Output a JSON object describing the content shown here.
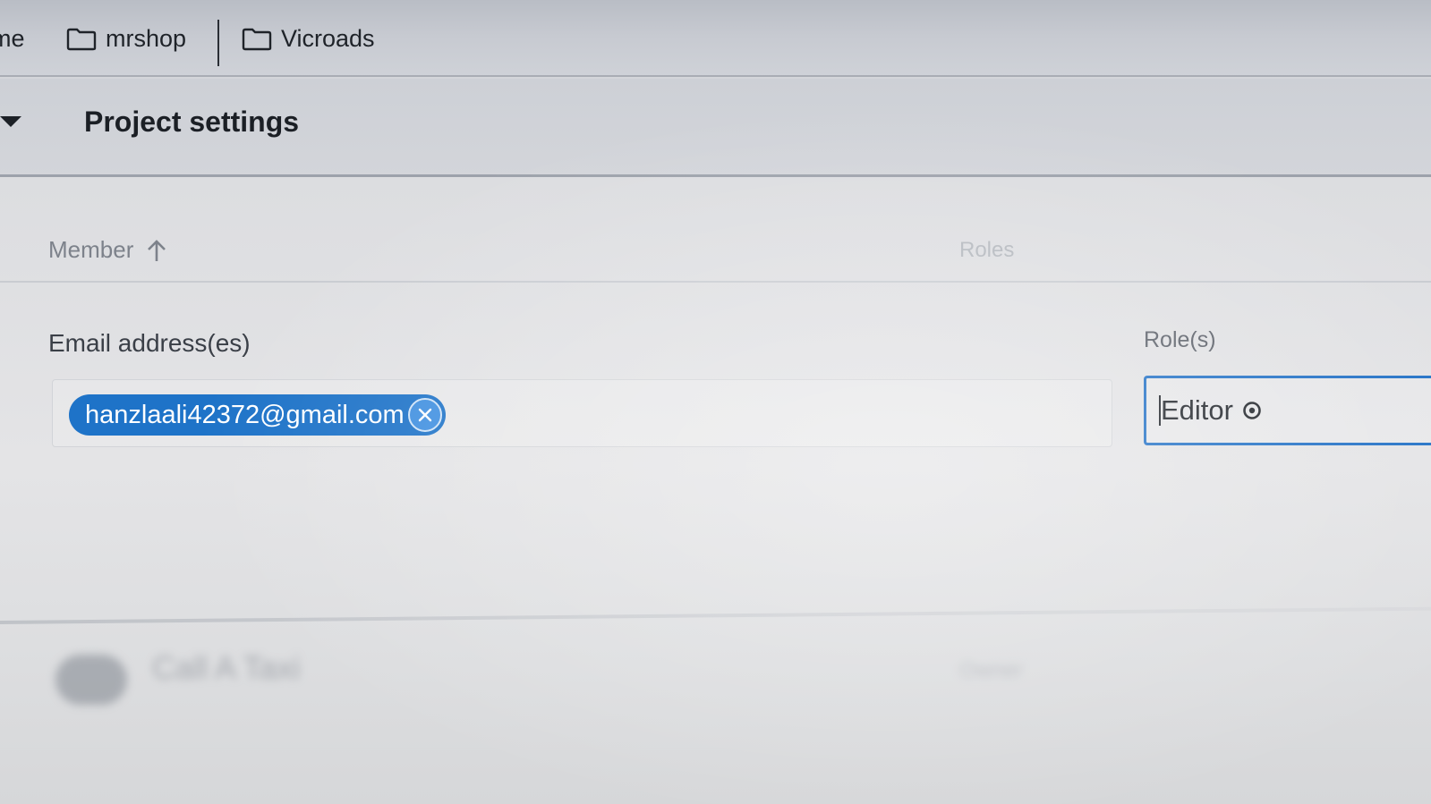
{
  "breadcrumb": {
    "items": [
      {
        "label": "me",
        "icon": "none"
      },
      {
        "label": "mrshop",
        "icon": "folder-icon"
      },
      {
        "label": "Vicroads",
        "icon": "folder-icon"
      }
    ]
  },
  "section": {
    "title": "Project settings"
  },
  "table": {
    "columns": {
      "member": "Member",
      "roles": "Roles"
    }
  },
  "add_member": {
    "email_label": "Email address(es)",
    "role_label": "Role(s)",
    "emails": [
      "hanzlaali42372@gmail.com"
    ],
    "role_value": "Editor"
  },
  "rows": [
    {
      "name": "Call A Taxi",
      "role": "Owner"
    }
  ],
  "colors": {
    "accent": "#1e73c8",
    "chip_text": "#ffffff",
    "focus_border": "#1f6fc5"
  }
}
